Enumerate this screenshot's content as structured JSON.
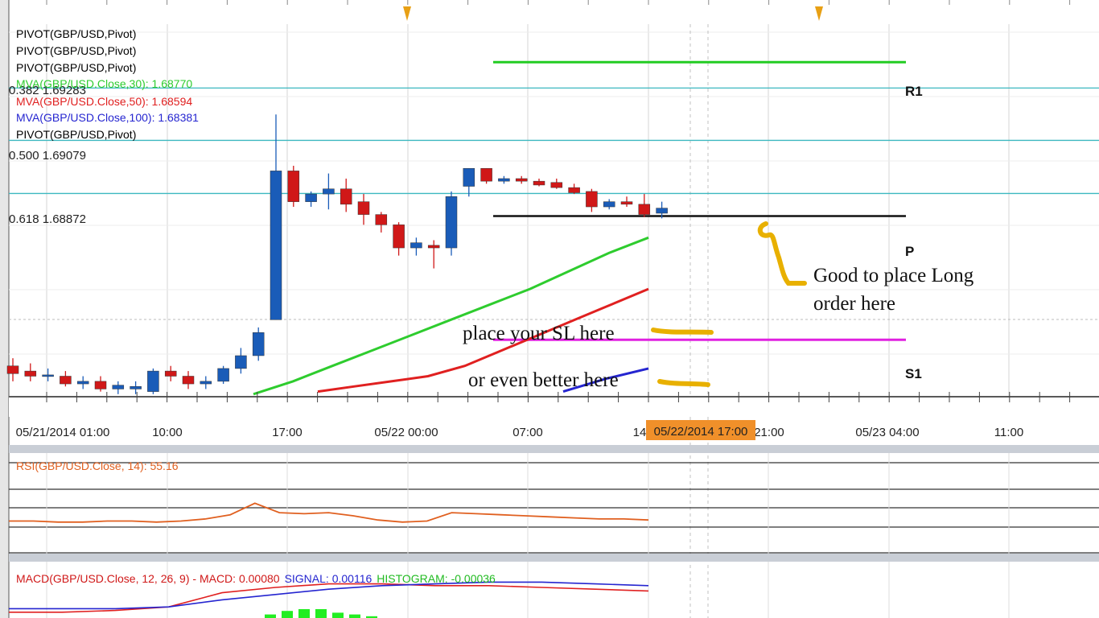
{
  "legend": [
    {
      "text": "PIVOT(GBP/USD,Pivot)",
      "color": "#000000"
    },
    {
      "text": "PIVOT(GBP/USD,Pivot)",
      "color": "#000000"
    },
    {
      "text": "PIVOT(GBP/USD,Pivot)",
      "color": "#000000"
    },
    {
      "text": "MVA(GBP/USD.Close,30): 1.68770",
      "color": "#2ecc2e"
    },
    {
      "text": "MVA(GBP/USD.Close,50): 1.68594",
      "color": "#e02020"
    },
    {
      "text": "MVA(GBP/USD.Close,100): 1.68381",
      "color": "#2525d0"
    },
    {
      "text": "PIVOT(GBP/USD,Pivot)",
      "color": "#000000"
    }
  ],
  "fib_levels": [
    {
      "label": "0.382 1.69283"
    },
    {
      "label": "0.500 1.69079"
    },
    {
      "label": "0.618 1.68872"
    }
  ],
  "pivot_labels": {
    "r1": "R1",
    "p": "P",
    "s1": "S1"
  },
  "x_ticks": [
    "05/21/2014 01:00",
    "10:00",
    "17:00",
    "05/22 00:00",
    "07:00",
    "14",
    "21:00",
    "05/23 04:00",
    "11:00"
  ],
  "time_highlight": "05/22/2014 17:00",
  "annotations": {
    "long": [
      "Good to place Long",
      "order here"
    ],
    "sl": "place your SL here",
    "sl_better": "or even better here"
  },
  "rsi_label": "RSI(GBP/USD.Close, 14): 55.16",
  "macd_label": {
    "main": "MACD(GBP/USD.Close, 12, 26, 9) -  MACD: 0.00080",
    "signal": "SIGNAL: 0.00116",
    "histogram": "HISTOGRAM: -0.00036"
  },
  "colors": {
    "up": "#1a5cb8",
    "down": "#d01818",
    "mva30": "#2ecc2e",
    "mva50": "#e02020",
    "mva100": "#2525d0",
    "fib": "#3cb8c0",
    "r1": "#22cc22",
    "s1": "#e020e0",
    "highlight": "#f0902a",
    "marker": "#e8a015"
  },
  "chart_data": {
    "type": "candlestick",
    "symbol": "GBP/USD",
    "candles": [
      {
        "o": 1.682,
        "h": 1.6823,
        "l": 1.6814,
        "c": 1.6817
      },
      {
        "o": 1.6818,
        "h": 1.6821,
        "l": 1.6814,
        "c": 1.6816
      },
      {
        "o": 1.6816,
        "h": 1.6819,
        "l": 1.6814,
        "c": 1.68165
      },
      {
        "o": 1.6816,
        "h": 1.6818,
        "l": 1.6812,
        "c": 1.6813
      },
      {
        "o": 1.6813,
        "h": 1.6816,
        "l": 1.6811,
        "c": 1.6814
      },
      {
        "o": 1.6814,
        "h": 1.6816,
        "l": 1.681,
        "c": 1.6811
      },
      {
        "o": 1.6811,
        "h": 1.6814,
        "l": 1.6809,
        "c": 1.68125
      },
      {
        "o": 1.6811,
        "h": 1.6814,
        "l": 1.6809,
        "c": 1.6812
      },
      {
        "o": 1.681,
        "h": 1.6819,
        "l": 1.6809,
        "c": 1.6818
      },
      {
        "o": 1.6818,
        "h": 1.682,
        "l": 1.6814,
        "c": 1.6816
      },
      {
        "o": 1.6816,
        "h": 1.6818,
        "l": 1.6811,
        "c": 1.6813
      },
      {
        "o": 1.6813,
        "h": 1.6816,
        "l": 1.6811,
        "c": 1.6814
      },
      {
        "o": 1.6814,
        "h": 1.682,
        "l": 1.6813,
        "c": 1.6819
      },
      {
        "o": 1.6819,
        "h": 1.6827,
        "l": 1.6817,
        "c": 1.6824
      },
      {
        "o": 1.6824,
        "h": 1.6835,
        "l": 1.6822,
        "c": 1.6833
      },
      {
        "o": 1.6838,
        "h": 1.6918,
        "l": 1.6838,
        "c": 1.6896
      },
      {
        "o": 1.6896,
        "h": 1.6898,
        "l": 1.6882,
        "c": 1.6884
      },
      {
        "o": 1.6884,
        "h": 1.6888,
        "l": 1.6882,
        "c": 1.6887
      },
      {
        "o": 1.6887,
        "h": 1.6895,
        "l": 1.6881,
        "c": 1.6889
      },
      {
        "o": 1.6889,
        "h": 1.6893,
        "l": 1.688,
        "c": 1.6883
      },
      {
        "o": 1.6884,
        "h": 1.6887,
        "l": 1.6875,
        "c": 1.6879
      },
      {
        "o": 1.6879,
        "h": 1.688,
        "l": 1.6872,
        "c": 1.6875
      },
      {
        "o": 1.6875,
        "h": 1.6876,
        "l": 1.6863,
        "c": 1.6866
      },
      {
        "o": 1.6866,
        "h": 1.687,
        "l": 1.6863,
        "c": 1.6868
      },
      {
        "o": 1.6867,
        "h": 1.6869,
        "l": 1.6858,
        "c": 1.6866
      },
      {
        "o": 1.6866,
        "h": 1.6888,
        "l": 1.6863,
        "c": 1.6886
      },
      {
        "o": 1.689,
        "h": 1.6897,
        "l": 1.6886,
        "c": 1.6897
      },
      {
        "o": 1.6897,
        "h": 1.6897,
        "l": 1.6891,
        "c": 1.6892
      },
      {
        "o": 1.6892,
        "h": 1.6894,
        "l": 1.6891,
        "c": 1.6893
      },
      {
        "o": 1.6893,
        "h": 1.6894,
        "l": 1.6891,
        "c": 1.6892
      },
      {
        "o": 1.6892,
        "h": 1.6893,
        "l": 1.689,
        "c": 1.68905
      },
      {
        "o": 1.68915,
        "h": 1.6893,
        "l": 1.6889,
        "c": 1.68895
      },
      {
        "o": 1.68895,
        "h": 1.6891,
        "l": 1.6887,
        "c": 1.68875
      },
      {
        "o": 1.6888,
        "h": 1.6889,
        "l": 1.688,
        "c": 1.6882
      },
      {
        "o": 1.6882,
        "h": 1.6885,
        "l": 1.6881,
        "c": 1.6884
      },
      {
        "o": 1.6884,
        "h": 1.6886,
        "l": 1.6882,
        "c": 1.6883
      },
      {
        "o": 1.6883,
        "h": 1.6887,
        "l": 1.6878,
        "c": 1.6879
      },
      {
        "o": 1.68795,
        "h": 1.6884,
        "l": 1.68775,
        "c": 1.68815
      }
    ],
    "pivot_levels": {
      "R1": 1.69384,
      "P": 1.68784,
      "S1": 1.68302
    },
    "fib_values": [
      1.69283,
      1.69079,
      1.68872
    ],
    "mva30": [
      1.6809,
      1.6814,
      1.682,
      1.6826,
      1.6832,
      1.6838,
      1.6844,
      1.685,
      1.6857,
      1.6864,
      1.687
    ],
    "mva50": [
      1.681,
      1.6812,
      1.6814,
      1.6816,
      1.682,
      1.6826,
      1.6832,
      1.6838,
      1.6844,
      1.685
    ],
    "mva100": [
      1.681,
      1.6815,
      1.6819
    ],
    "rsi": [
      45,
      45,
      44,
      44,
      45,
      45,
      44,
      45,
      47,
      51,
      62,
      53,
      52,
      53,
      50,
      46,
      44,
      45,
      53,
      52,
      51,
      50,
      49,
      48,
      47,
      47,
      46
    ],
    "macd": [
      -0.0004,
      -0.0004,
      -0.0003,
      -0.0001,
      0.0007,
      0.001,
      0.0012,
      0.0012,
      0.0011,
      0.0011,
      0.001,
      0.0009,
      0.0008
    ],
    "signal": [
      -0.0002,
      -0.0002,
      -0.0002,
      -0.0001,
      0.0003,
      0.0006,
      0.0009,
      0.0011,
      0.0012,
      0.0013,
      0.0013,
      0.0012,
      0.0011
    ],
    "histogram": [
      0.0002,
      0.0004,
      0.0005,
      0.0005,
      0.0003,
      0.0002,
      0.0001
    ]
  }
}
